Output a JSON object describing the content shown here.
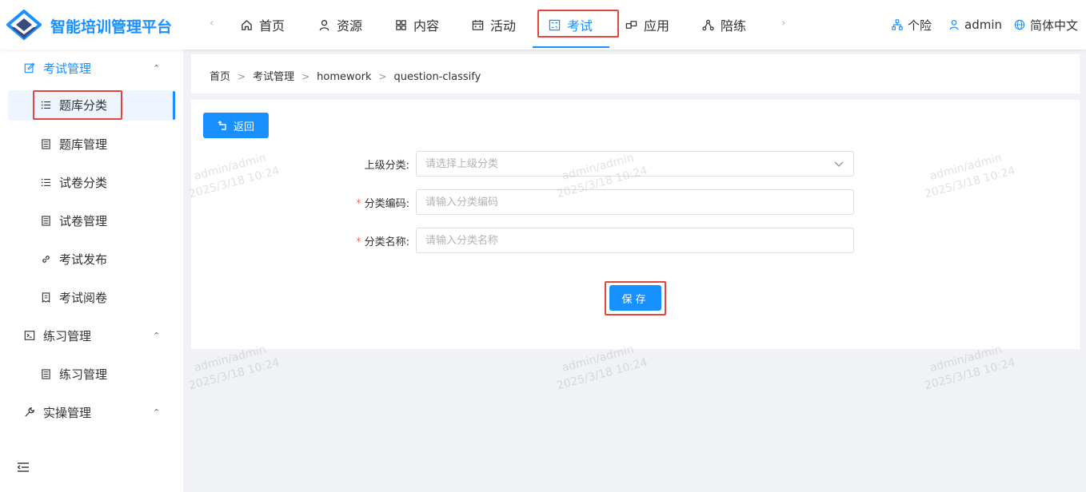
{
  "app": {
    "title": "智能培训管理平台",
    "accent_color": "#1890ff",
    "highlight_color": "#e3463c"
  },
  "topnav": {
    "prev_arrow": "‹",
    "next_arrow": "›",
    "items": [
      {
        "label": "首页",
        "icon": "home-icon"
      },
      {
        "label": "资源",
        "icon": "user-icon"
      },
      {
        "label": "内容",
        "icon": "grid-icon"
      },
      {
        "label": "活动",
        "icon": "calendar-icon"
      },
      {
        "label": "考试",
        "icon": "exam-icon",
        "active": true
      },
      {
        "label": "应用",
        "icon": "apps-icon"
      },
      {
        "label": "陪练",
        "icon": "network-icon"
      }
    ]
  },
  "header_right": {
    "org": "个险",
    "user": "admin",
    "language": "简体中文"
  },
  "sidebar": {
    "groups": [
      {
        "label": "考试管理",
        "icon": "edit-icon",
        "expanded": true,
        "caret": "⌃",
        "items": [
          {
            "label": "题库分类",
            "icon": "list-icon",
            "active": true
          },
          {
            "label": "题库管理",
            "icon": "doc-icon"
          },
          {
            "label": "试卷分类",
            "icon": "list-icon"
          },
          {
            "label": "试卷管理",
            "icon": "doc-icon"
          },
          {
            "label": "考试发布",
            "icon": "link-icon"
          },
          {
            "label": "考试阅卷",
            "icon": "receipt-icon"
          }
        ]
      },
      {
        "label": "练习管理",
        "icon": "terminal-icon",
        "expanded": true,
        "caret": "⌃",
        "items": [
          {
            "label": "练习管理",
            "icon": "doc-icon"
          }
        ]
      },
      {
        "label": "实操管理",
        "icon": "wrench-icon",
        "expanded": true,
        "caret": "⌃",
        "items": []
      }
    ]
  },
  "breadcrumb": {
    "items": [
      "首页",
      "考试管理",
      "homework",
      "question-classify"
    ],
    "separator": ">"
  },
  "form": {
    "back_label": "返回",
    "fields": [
      {
        "label": "上级分类:",
        "placeholder": "请选择上级分类",
        "required": false,
        "type": "select"
      },
      {
        "label": "分类编码:",
        "placeholder": "请输入分类编码",
        "required": true,
        "type": "text"
      },
      {
        "label": "分类名称:",
        "placeholder": "请输入分类名称",
        "required": true,
        "type": "text"
      }
    ],
    "required_mark": "*",
    "save_label": "保存"
  },
  "watermark": {
    "line1": "admin/admin",
    "line2": "2025/3/18 10:24"
  }
}
